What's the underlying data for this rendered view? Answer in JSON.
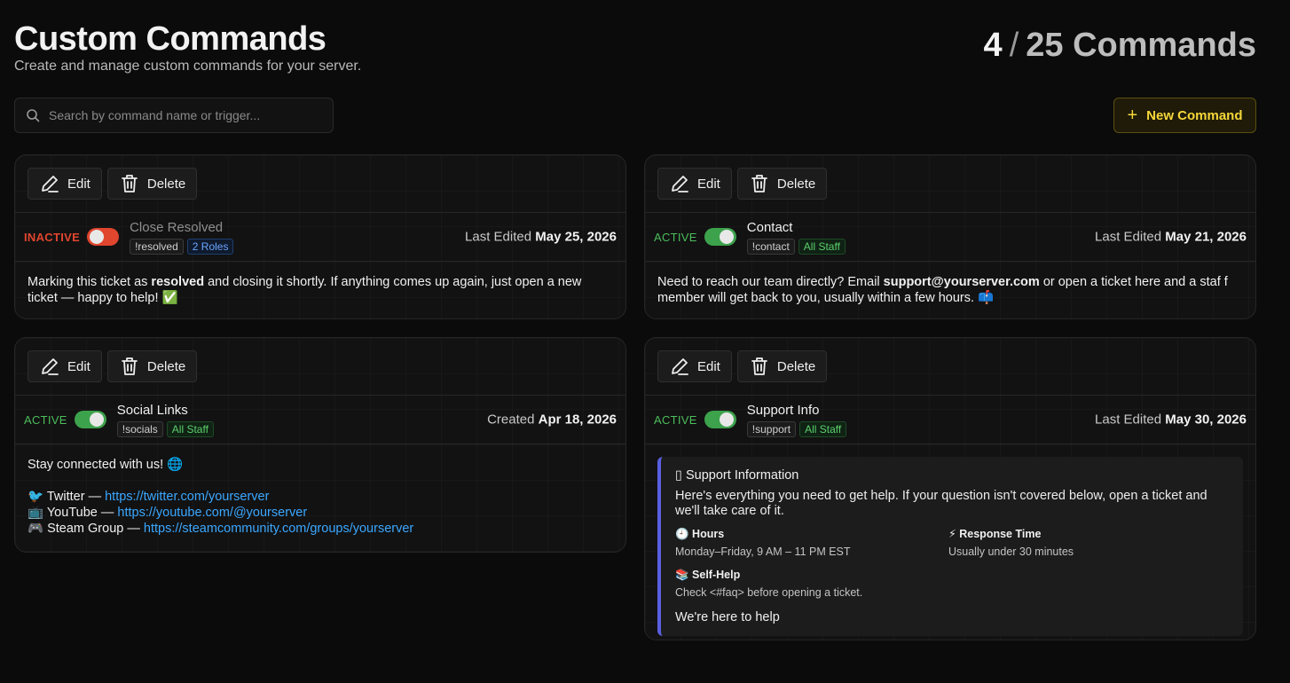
{
  "header": {
    "title": "Custom Commands",
    "subtitle": "Create and manage custom commands for your server.",
    "count_current": "4",
    "count_separator": "/",
    "count_total": "25 Commands"
  },
  "search": {
    "placeholder": "Search by command name or trigger..."
  },
  "new_button": {
    "label": "New Command",
    "color": "#f5d73a"
  },
  "labels": {
    "edit": "Edit",
    "delete": "Delete"
  },
  "cards": [
    {
      "status": "INACTIVE",
      "enabled": false,
      "name": "Close Resolved",
      "trigger": "!resolved",
      "access": "2 Roles",
      "date_label": "Last Edited",
      "date": "May 25, 2026",
      "body": {
        "pre": "Marking this ticket as ",
        "bold": "resolved",
        "post": " and closing it shortly. If anything comes up again, just open a new ticket — happy to help! ✅"
      }
    },
    {
      "status": "ACTIVE",
      "enabled": true,
      "name": "Contact",
      "trigger": "!contact",
      "access": "All Staff",
      "date_label": "Last Edited",
      "date": "May 21, 2026",
      "body": {
        "pre": "Need to reach our team directly? Email ",
        "bold": "support@yourserver.com",
        "post": " or open a ticket here and a staf f member will get back to you, usually within a few hours. 📫"
      }
    },
    {
      "status": "ACTIVE",
      "enabled": true,
      "name": "Social Links",
      "trigger": "!socials",
      "access": "All Staff",
      "date_label": "Created",
      "date": "Apr 18, 2026",
      "body": {
        "intro": "Stay connected with us! 🌐",
        "links": [
          {
            "icon": "🐦",
            "label": "Twitter — ",
            "url": "https://twitter.com/yourserver"
          },
          {
            "icon": "📺",
            "label": "YouTube — ",
            "url": "https://youtube.com/@yourserver"
          },
          {
            "icon": "🎮",
            "label": "Steam Group — ",
            "url": "https://steamcommunity.com/groups/yourserver"
          }
        ]
      }
    },
    {
      "status": "ACTIVE",
      "enabled": true,
      "name": "Support Info",
      "trigger": "!support",
      "access": "All Staff",
      "date_label": "Last Edited",
      "date": "May 30, 2026",
      "embed": {
        "title": "▯ Support Information",
        "description": "Here's everything you need to get help. If your question isn't covered below, open a ticket and we'll take care of it.",
        "fields": [
          {
            "name": "🕘 Hours",
            "value": "Monday–Friday, 9 AM – 11 PM EST"
          },
          {
            "name": "⚡ Response Time",
            "value": "Usually under 30 minutes"
          },
          {
            "name": "📚 Self-Help",
            "value": "Check <#faq> before opening a ticket."
          }
        ],
        "footer": "We're here to help",
        "accent": "#5a5fe0"
      }
    }
  ]
}
